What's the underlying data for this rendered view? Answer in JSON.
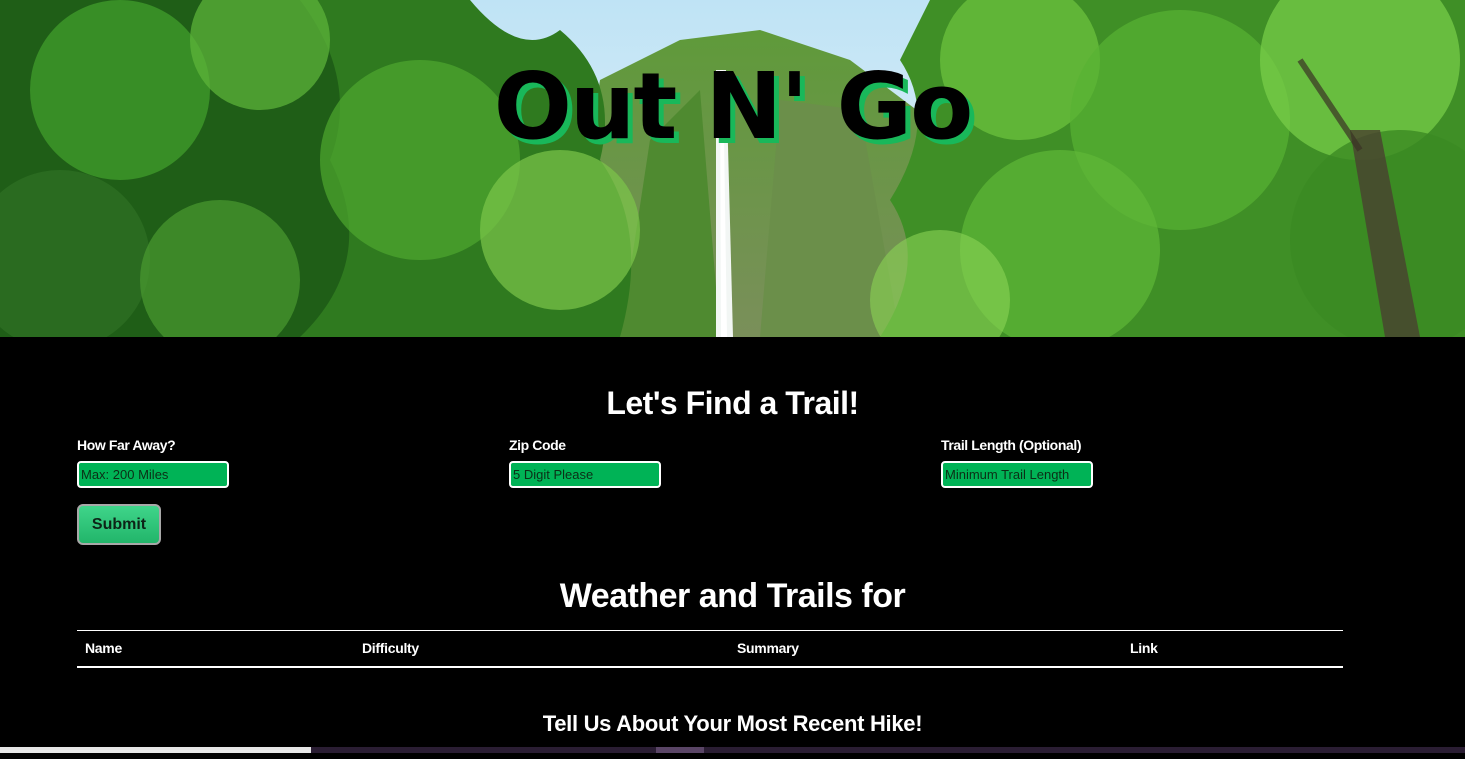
{
  "hero": {
    "title": "Out N' Go"
  },
  "search": {
    "heading": "Let's Find a Trail!",
    "distance": {
      "label": "How Far Away?",
      "placeholder": "Max: 200 Miles"
    },
    "zip": {
      "label": "Zip Code",
      "placeholder": "5 Digit Please"
    },
    "length": {
      "label": "Trail Length (Optional)",
      "placeholder": "Minimum Trail Length"
    },
    "submit_label": "Submit"
  },
  "results": {
    "heading": "Weather and Trails for",
    "columns": [
      "Name",
      "Difficulty",
      "Summary",
      "Link"
    ]
  },
  "hike": {
    "heading": "Tell Us About Your Most Recent Hike!"
  },
  "colors": {
    "accent": "#00b356",
    "title_shadow": "#19b85a",
    "background": "#000000"
  }
}
